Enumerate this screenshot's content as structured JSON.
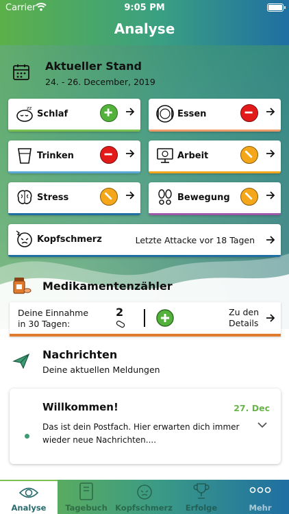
{
  "status_bar": {
    "carrier": "Carrier",
    "time": "9:05 PM"
  },
  "nav": {
    "title": "Analyse"
  },
  "current": {
    "title": "Aktueller Stand",
    "date_range": "24. - 26. December, 2019"
  },
  "tiles": [
    {
      "label": "Schlaf",
      "icon": "sleep-icon",
      "status": "good"
    },
    {
      "label": "Essen",
      "icon": "food-icon",
      "status": "bad"
    },
    {
      "label": "Trinken",
      "icon": "drink-icon",
      "status": "bad"
    },
    {
      "label": "Arbeit",
      "icon": "work-icon",
      "status": "mid"
    },
    {
      "label": "Stress",
      "icon": "brain-icon",
      "status": "mid"
    },
    {
      "label": "Bewegung",
      "icon": "footprints-icon",
      "status": "mid"
    }
  ],
  "headache": {
    "label": "Kopfschmerz",
    "last_attack": "Letzte Attacke vor 18 Tagen"
  },
  "medication": {
    "title": "Medikamentenzähler",
    "intake_label_line1": "Deine Einnahme",
    "intake_label_line2": "in 30 Tagen:",
    "count": "2",
    "details_line1": "Zu den",
    "details_line2": "Details"
  },
  "messages": {
    "title": "Nachrichten",
    "subtitle": "Deine aktuellen Meldungen",
    "item": {
      "title": "Willkommen!",
      "date": "27. Dec",
      "body_line1": "Das ist dein Postfach. Hier erwarten dich immer",
      "body_line2": "wieder neue Nachrichten...."
    }
  },
  "tabbar": [
    {
      "label": "Analyse",
      "icon": "eye-icon",
      "active": true
    },
    {
      "label": "Tagebuch",
      "icon": "diary-icon",
      "active": false
    },
    {
      "label": "Kopfschmerz",
      "icon": "headache-face-icon",
      "active": false
    },
    {
      "label": "Erfolge",
      "icon": "trophy-icon",
      "active": false
    },
    {
      "label": "Mehr",
      "icon": "more-icon",
      "active": false
    }
  ],
  "colors": {
    "good": "#54b23c",
    "bad": "#e21a1a",
    "mid": "#f5a71b",
    "accent": "#e07a2d",
    "date_green": "#6ab54b"
  }
}
